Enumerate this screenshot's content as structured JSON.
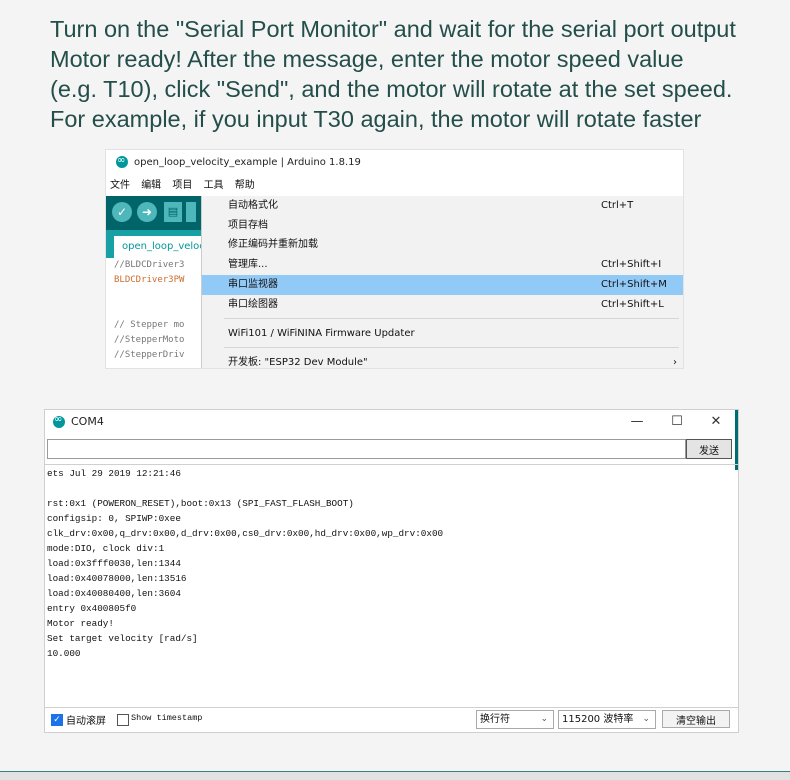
{
  "instructions": {
    "line1": "Turn on the \"Serial Port Monitor\" and wait for the serial port output",
    "line2": "Motor ready! After the message, enter the motor speed value",
    "line3": "(e.g. T10), click \"Send\", and the motor will rotate at the set speed.",
    "line4": "For example, if you input T30 again, the motor will rotate faster"
  },
  "ide": {
    "title": "open_loop_velocity_example | Arduino 1.8.19",
    "menubar": [
      "文件",
      "编辑",
      "项目",
      "工具",
      "帮助"
    ],
    "tab_label": "open_loop_velocity_example",
    "code_lines": [
      "//BLDCDriver3",
      "BLDCDriver3PW",
      "// Stepper mo",
      "//StepperMoto",
      "//StepperDriv"
    ],
    "tools_menu": [
      {
        "label": "自动格式化",
        "shortcut": "Ctrl+T"
      },
      {
        "label": "项目存档",
        "shortcut": ""
      },
      {
        "label": "修正编码并重新加载",
        "shortcut": ""
      },
      {
        "label": "管理库...",
        "shortcut": "Ctrl+Shift+I"
      },
      {
        "label": "串口监视器",
        "shortcut": "Ctrl+Shift+M"
      },
      {
        "label": "串口绘图器",
        "shortcut": "Ctrl+Shift+L"
      },
      {
        "label": "WiFi101 / WiFiNINA Firmware Updater",
        "shortcut": ""
      },
      {
        "label": "开发板: \"ESP32 Dev Module\"",
        "shortcut": "›"
      }
    ]
  },
  "serial_monitor": {
    "title": "COM4",
    "window_controls": {
      "minimize": "—",
      "maximize": "☐",
      "close": "✕"
    },
    "input_value": "",
    "send_label": "发送",
    "output_lines": [
      "ets Jul 29 2019 12:21:46",
      "",
      "rst:0x1 (POWERON_RESET),boot:0x13 (SPI_FAST_FLASH_BOOT)",
      "configsip: 0, SPIWP:0xee",
      "clk_drv:0x00,q_drv:0x00,d_drv:0x00,cs0_drv:0x00,hd_drv:0x00,wp_drv:0x00",
      "mode:DIO, clock div:1",
      "load:0x3fff0030,len:1344",
      "load:0x40078000,len:13516",
      "load:0x40080400,len:3604",
      "entry 0x400805f0",
      "Motor ready!",
      "Set target velocity [rad/s]",
      "10.000"
    ],
    "autoscroll_label": "自动滚屏",
    "autoscroll_checked": "✓",
    "timestamp_label": "Show timestamp",
    "line_ending": "换行符",
    "baud": "115200 波特率",
    "clear_label": "清空输出"
  }
}
